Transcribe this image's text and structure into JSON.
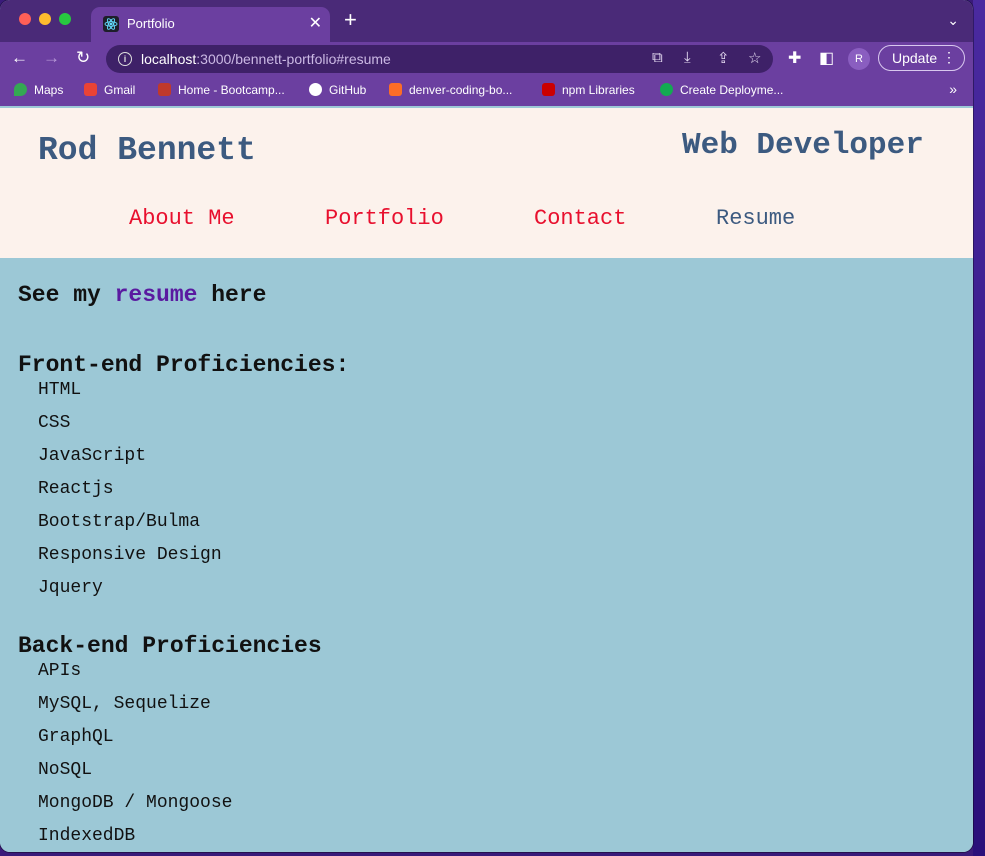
{
  "browser": {
    "tab": {
      "title": "Portfolio"
    },
    "url": {
      "host": "localhost",
      "path": ":3000/bennett-portfolio#resume"
    },
    "profile_initial": "R",
    "update_label": "Update",
    "bookmarks": [
      "Maps",
      "Gmail",
      "Home - Bootcamp...",
      "GitHub",
      "denver-coding-bo...",
      "npm Libraries",
      "Create Deployme..."
    ]
  },
  "site": {
    "name": "Rod Bennett",
    "role": "Web Developer",
    "nav": [
      "About Me",
      "Portfolio",
      "Contact",
      "Resume"
    ]
  },
  "resume": {
    "prefix": "See my ",
    "link": "resume",
    "suffix": " here",
    "frontend": {
      "title": "Front-end Proficiencies:",
      "items": [
        "HTML",
        "CSS",
        "JavaScript",
        "Reactjs",
        "Bootstrap/Bulma",
        "Responsive Design",
        "Jquery"
      ]
    },
    "backend": {
      "title": "Back-end Proficiencies",
      "items": [
        "APIs",
        "MySQL, Sequelize",
        "GraphQL",
        "NoSQL",
        "MongoDB / Mongoose",
        "IndexedDB"
      ]
    }
  },
  "colors": {
    "browser_chrome": "#6b3fa0",
    "header_bg": "#fcf2ec",
    "page_bg": "#9cc8d6",
    "heading": "#3c5a80",
    "nav_link": "#e8102e",
    "resume_link": "#5a1aa0"
  }
}
